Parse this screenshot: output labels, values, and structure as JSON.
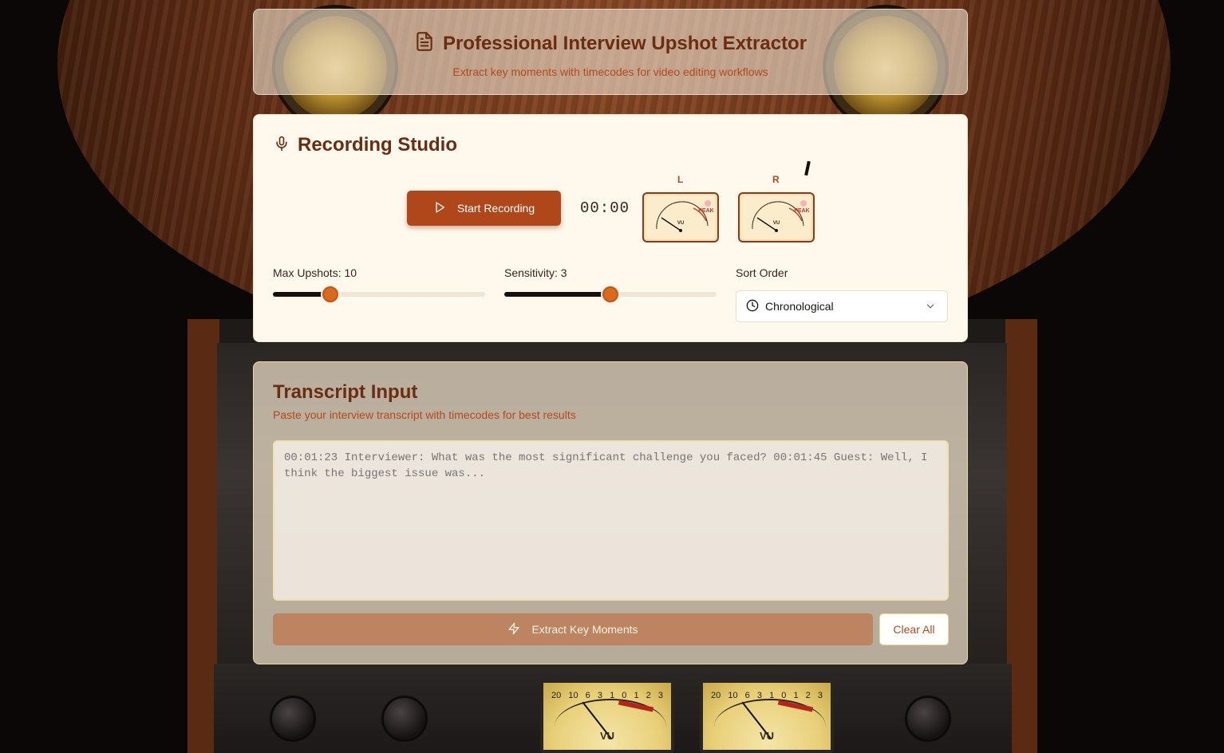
{
  "header": {
    "title": "Professional Interview Upshot Extractor",
    "subtitle": "Extract key moments with timecodes for video editing workflows",
    "icon": "document-icon"
  },
  "studio": {
    "title": "Recording Studio",
    "icon": "microphone-icon",
    "record_button_label": "Start Recording",
    "timer": "00:00",
    "meters": [
      {
        "channel": "L",
        "label": "VU",
        "peak_label": "PEAK"
      },
      {
        "channel": "R",
        "label": "VU",
        "peak_label": "PEAK"
      }
    ],
    "max_upshots": {
      "label": "Max Upshots: 10",
      "value": 10,
      "fraction": 0.27
    },
    "sensitivity": {
      "label": "Sensitivity: 3",
      "value": 3,
      "fraction": 0.5
    },
    "sort": {
      "label": "Sort Order",
      "selected": "Chronological",
      "icon": "clock-icon"
    }
  },
  "transcript": {
    "title": "Transcript Input",
    "subtitle": "Paste your interview transcript with timecodes for best results",
    "placeholder": "00:01:23 Interviewer: What was the most significant challenge you faced? 00:01:45 Guest: Well, I think the biggest issue was...",
    "extract_label": "Extract Key Moments",
    "clear_label": "Clear All"
  },
  "background": {
    "meter_scale": [
      "20",
      "10",
      "6",
      "3",
      "1",
      "0",
      "1",
      "2",
      "3"
    ],
    "meter_label": "VU"
  },
  "colors": {
    "accent": "#b0471a",
    "heading": "#6b2d12",
    "subtext": "#b4491c",
    "slider_thumb": "#d86a1c"
  }
}
